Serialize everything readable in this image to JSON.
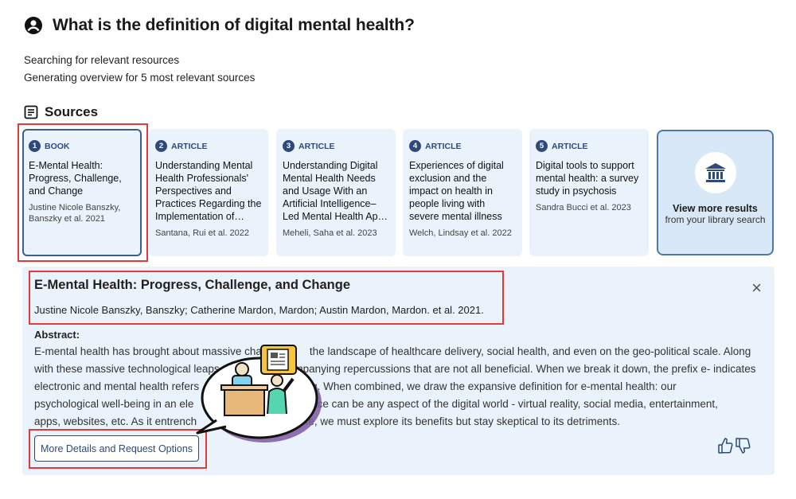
{
  "question": {
    "text": "What is the definition of digital mental health?",
    "icon": "user-circle-icon"
  },
  "status_lines": [
    "Searching for relevant resources",
    "Generating overview for 5 most relevant sources"
  ],
  "sources": {
    "heading": "Sources",
    "icon": "document-list-icon",
    "cards": [
      {
        "num": "1",
        "type": "BOOK",
        "title": "E-Mental Health: Progress, Challenge, and Change",
        "author": "Justine Nicole Banszky, Banszky et al. 2021"
      },
      {
        "num": "2",
        "type": "ARTICLE",
        "title": "Understanding Mental Health Professionals' Perspectives and Practices Regarding the Implementation of…",
        "author": "Santana, Rui et al. 2022"
      },
      {
        "num": "3",
        "type": "ARTICLE",
        "title": "Understanding Digital Mental Health Needs and Usage With an Artificial Intelligence–Led Mental Health Ap…",
        "author": "Meheli, Saha et al. 2023"
      },
      {
        "num": "4",
        "type": "ARTICLE",
        "title": "Experiences of digital exclusion and the impact on health in people living with severe mental illness",
        "author": "Welch, Lindsay et al. 2022"
      },
      {
        "num": "5",
        "type": "ARTICLE",
        "title": "Digital tools to support mental health: a survey study in psychosis",
        "author": "Sandra Bucci et al. 2023"
      }
    ],
    "more": {
      "label": "View more results",
      "sub": "from your library search",
      "icon": "library-icon"
    }
  },
  "detail": {
    "title": "E-Mental Health: Progress, Challenge, and Change",
    "authors": "Justine Nicole Banszky, Banszky; Catherine Mardon, Mardon; Austin Mardon, Mardon. et al. 2021.",
    "close": "×",
    "abstract_heading": "Abstract:",
    "abstract_lines": [
      "E-mental health has brought about massive cha                the landscape of healthcare delivery, social health, and even on the geo-political scale. Along",
      "with these massive technological leaps, th                    mpanying repercussions that are not all beneficial. When we break it down, the prefix e- indicates",
      "electronic and mental health refers                          ell-being. When combined, we draw the expansive definition for e-mental health: our",
      "psychological well-being in an ele                              nic space can be any aspect of the digital world - virtual reality, social media, entertainment,",
      "apps, websites, etc. As it entrench                              ay life, we must explore its benefits but stay skeptical to its detriments."
    ],
    "button": "More Details and Request Options",
    "feedback_icons": [
      "thumbs-up-icon",
      "thumbs-down-icon"
    ]
  },
  "colors": {
    "accent": "#2d4a7a",
    "highlight": "#e13b3b",
    "panel": "#eaf2fb"
  }
}
